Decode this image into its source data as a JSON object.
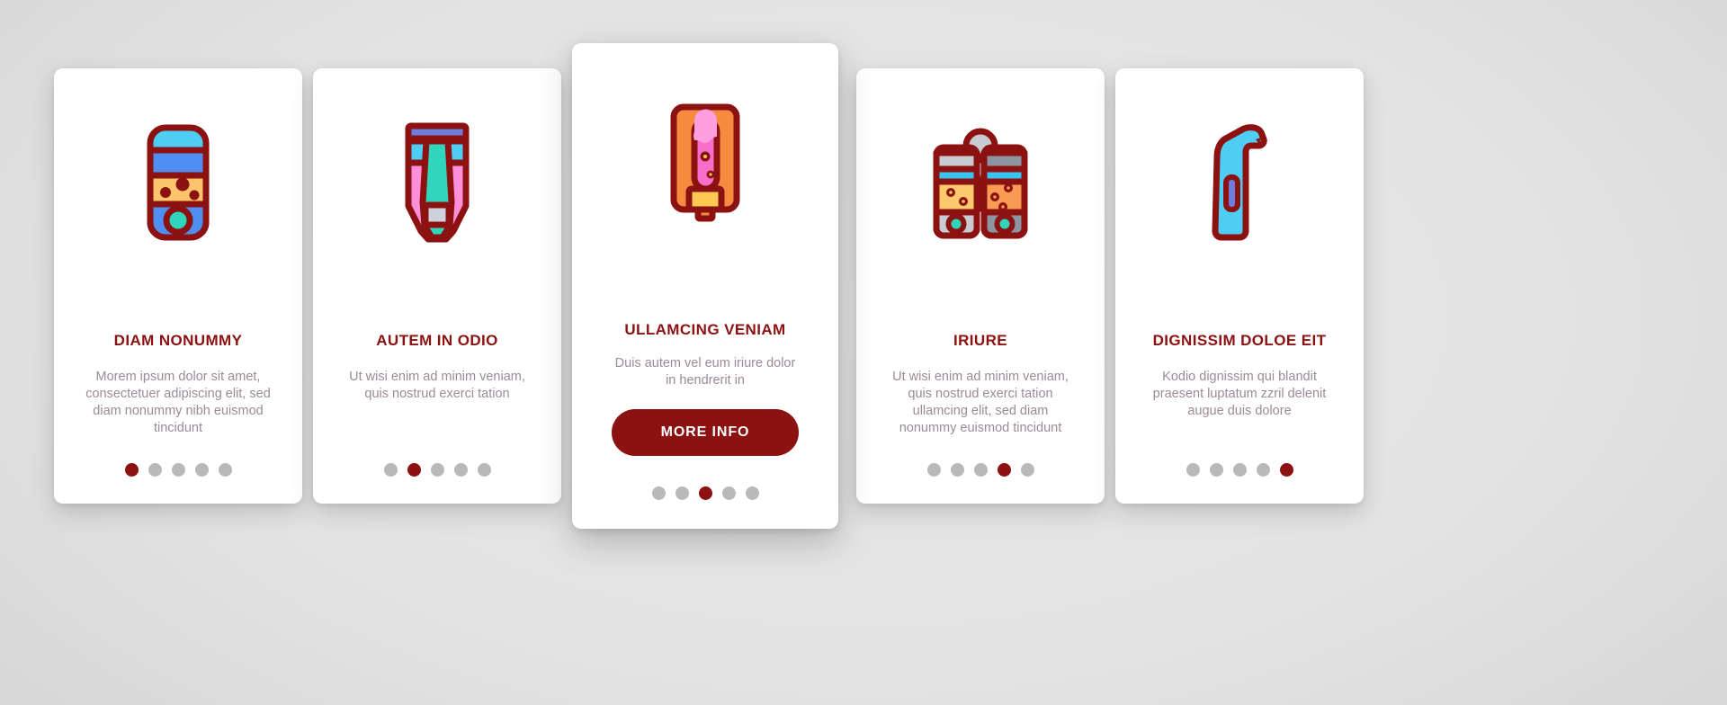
{
  "theme": {
    "accent": "#8c1111",
    "card_bg": "#ffffff",
    "body_text": "#9b8b97",
    "dot_inactive": "#b9b9b9",
    "background": "#dcdcdc"
  },
  "cards": [
    {
      "icon": "lava-lamp-bottle-icon",
      "title": "DIAM NONUMMY",
      "description": "Morem ipsum dolor sit amet, consectetuer adipiscing elit, sed diam nonummy nibh euismod tincidunt",
      "dots": {
        "count": 5,
        "active_index": 0
      },
      "button": null
    },
    {
      "icon": "pink-teal-bottle-icon",
      "title": "AUTEM IN ODIO",
      "description": "Ut wisi enim ad minim veniam, quis nostrud exerci tation",
      "dots": {
        "count": 5,
        "active_index": 1
      },
      "button": null
    },
    {
      "icon": "orange-soap-dispenser-icon",
      "title": "ULLAMCING VENIAM",
      "description": "Duis autem vel eum iriure dolor in hendrerit in",
      "dots": {
        "count": 5,
        "active_index": 2
      },
      "button": {
        "label": "MORE INFO"
      }
    },
    {
      "icon": "two-bottles-spoon-icon",
      "title": "IRIURE",
      "description": "Ut wisi enim ad minim veniam, quis nostrud exerci tation ullamcing elit, sed diam nonummy euismod tincidunt",
      "dots": {
        "count": 5,
        "active_index": 3
      },
      "button": null
    },
    {
      "icon": "spray-bottle-icon",
      "title": "DIGNISSIM DOLOE EIT",
      "description": "Kodio dignissim qui blandit praesent luptatum zzril delenit augue duis dolore",
      "dots": {
        "count": 5,
        "active_index": 4
      },
      "button": null
    }
  ]
}
